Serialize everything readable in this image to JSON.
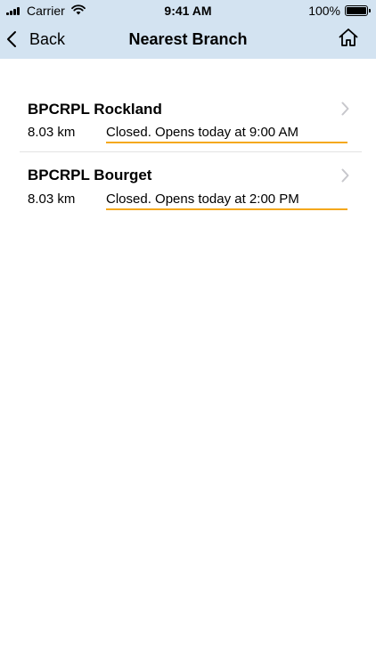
{
  "status_bar": {
    "carrier": "Carrier",
    "time": "9:41 AM",
    "battery": "100%",
    "signal_icon": "signal-bars-icon",
    "wifi_icon": "wifi-icon",
    "battery_icon": "battery-icon"
  },
  "nav": {
    "back_label": "Back",
    "title": "Nearest Branch",
    "home_icon": "home-icon"
  },
  "branches": [
    {
      "name": "BPCRPL Rockland",
      "distance": "8.03 km",
      "status": "Closed. Opens today at 9:00 AM"
    },
    {
      "name": "BPCRPL Bourget",
      "distance": "8.03 km",
      "status": "Closed. Opens today at 2:00 PM"
    }
  ],
  "colors": {
    "header_bg": "#d3e3f1",
    "status_underline": "#f4a81c",
    "chevron": "#c7c7cc"
  }
}
